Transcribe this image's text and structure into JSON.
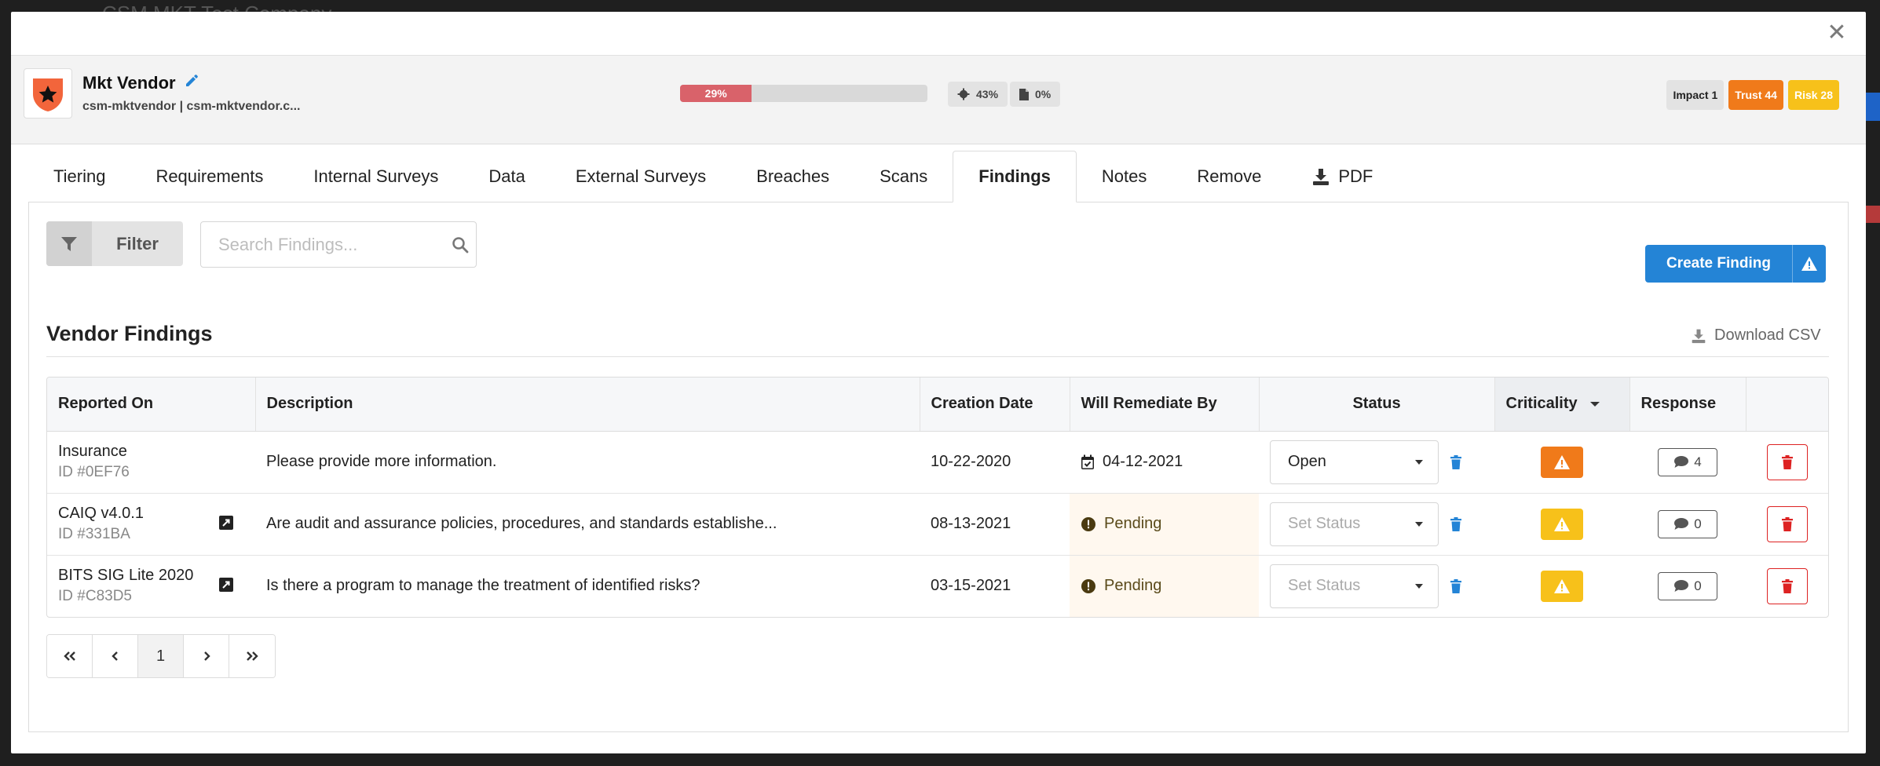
{
  "background": {
    "title": "CSM MKT Test Company"
  },
  "modal": {
    "close_icon": "close-icon"
  },
  "vendor": {
    "name": "Mkt Vendor",
    "subtitle": "csm-mktvendor | csm-mktvendor.c...",
    "logo_icon": "star-shield-icon",
    "progress_percent": 29,
    "progress_label": "29%",
    "stat_scan": "43%",
    "stat_doc": "0%",
    "badges": {
      "impact": "Impact 1",
      "trust": "Trust 44",
      "risk": "Risk 28"
    }
  },
  "tabs": [
    {
      "label": "Tiering"
    },
    {
      "label": "Requirements"
    },
    {
      "label": "Internal Surveys"
    },
    {
      "label": "Data"
    },
    {
      "label": "External Surveys"
    },
    {
      "label": "Breaches"
    },
    {
      "label": "Scans"
    },
    {
      "label": "Findings",
      "active": true
    },
    {
      "label": "Notes"
    },
    {
      "label": "Remove"
    },
    {
      "label": "PDF"
    }
  ],
  "toolbar": {
    "filter_label": "Filter",
    "search_placeholder": "Search Findings...",
    "create_label": "Create Finding"
  },
  "section": {
    "title": "Vendor Findings",
    "download_csv": "Download CSV"
  },
  "table": {
    "headers": {
      "reported_on": "Reported On",
      "description": "Description",
      "creation_date": "Creation Date",
      "will_remediate_by": "Will Remediate By",
      "status": "Status",
      "criticality": "Criticality",
      "response": "Response"
    },
    "rows": [
      {
        "reported_on": "Insurance",
        "id": "ID #0EF76",
        "description": "Please provide more information.",
        "creation_date": "10-22-2020",
        "remediate": "04-12-2021",
        "status": "Open",
        "criticality": "high",
        "response_count": "4"
      },
      {
        "reported_on": "CAIQ v4.0.1",
        "id": "ID #331BA",
        "description": "Are audit and assurance policies, procedures, and standards establishe...",
        "creation_date": "08-13-2021",
        "remediate": "Pending",
        "status": "Set Status",
        "criticality": "medium",
        "response_count": "0"
      },
      {
        "reported_on": "BITS SIG Lite 2020",
        "id": "ID #C83D5",
        "description": "Is there a program to manage the treatment of identified risks?",
        "creation_date": "03-15-2021",
        "remediate": "Pending",
        "status": "Set Status",
        "criticality": "medium",
        "response_count": "0"
      }
    ]
  },
  "pagination": {
    "current_page": "1"
  },
  "colors": {
    "primary": "#2484d6",
    "orange": "#f07a1a",
    "yellow": "#f7c11a",
    "danger": "#d22222",
    "progress": "#d9626a"
  }
}
